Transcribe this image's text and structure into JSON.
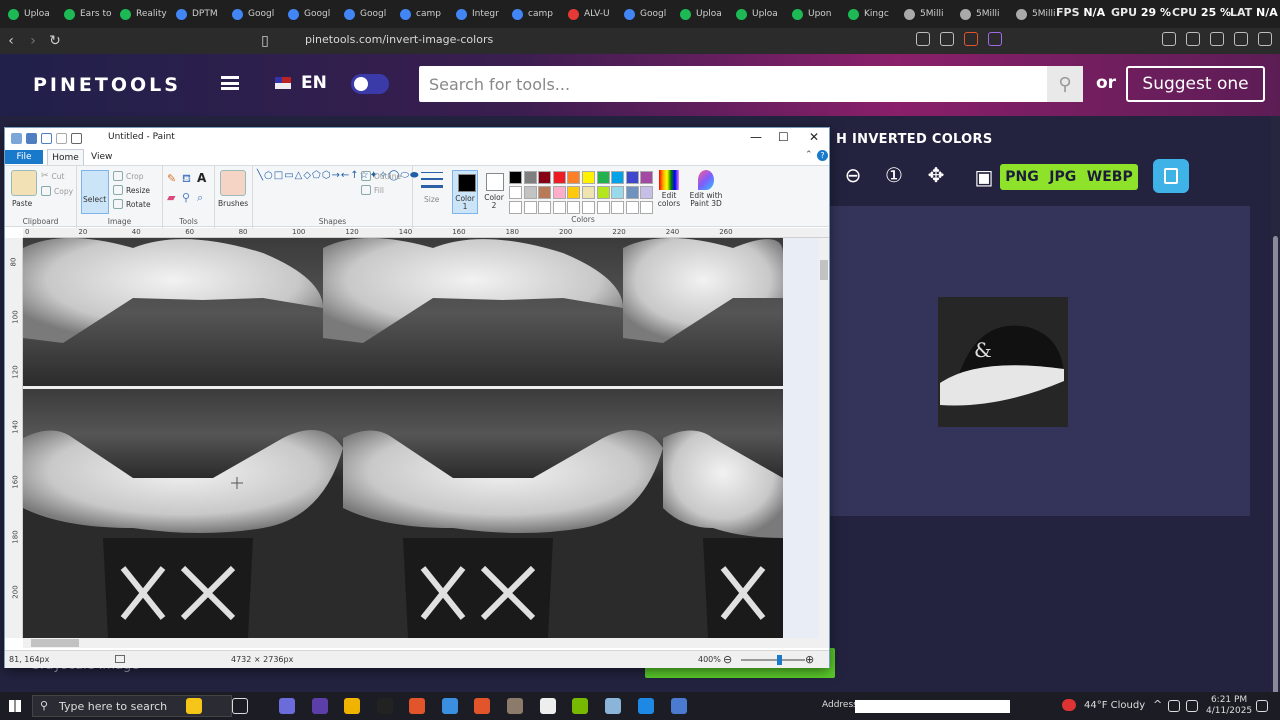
{
  "browser": {
    "tabs": [
      "Uploa",
      "Ears to",
      "Reality",
      "DPTM",
      "Googl",
      "Googl",
      "Googl",
      "camp",
      "Integr",
      "camp",
      "ALV-U",
      "Googl",
      "Uploa",
      "Uploa",
      "Upon",
      "Kingc",
      "5Milli",
      "5Milli",
      "5Milli"
    ],
    "tab_colors": [
      "#1db954",
      "#1db954",
      "#1db954",
      "#4285f4",
      "#4285f4",
      "#4285f4",
      "#4285f4",
      "#4285f4",
      "#4285f4",
      "#4285f4",
      "#e53935",
      "#4285f4",
      "#1db954",
      "#1db954",
      "#1db954",
      "#1db954",
      "#aaaaaa",
      "#aaaaaa",
      "#aaaaaa"
    ],
    "url": "pinetools.com/invert-image-colors",
    "overlay": {
      "fps_label": "FPS",
      "fps": "N/A",
      "gpu_label": "GPU",
      "gpu": "29 %",
      "cpu_label": "CPU",
      "cpu": "25 %",
      "lat_label": "LAT",
      "lat": "N/A"
    }
  },
  "site": {
    "logo": "PINETOOLS",
    "lang": "EN",
    "search_placeholder": "Search for tools...",
    "or": "or",
    "suggest": "Suggest one",
    "panel_title": "H INVERTED COLORS",
    "formats": [
      "PNG",
      "JPG",
      "WEBP"
    ],
    "gray_label": "Grayscale image"
  },
  "paint": {
    "title": "Untitled - Paint",
    "tabs": {
      "file": "File",
      "home": "Home",
      "view": "View"
    },
    "groups": {
      "clipboard": "Clipboard",
      "image": "Image",
      "tools": "Tools",
      "shapes": "Shapes",
      "colors": "Colors"
    },
    "clipboard": {
      "paste": "Paste",
      "cut": "Cut",
      "copy": "Copy"
    },
    "image": {
      "select": "Select",
      "crop": "Crop",
      "resize": "Resize",
      "rotate": "Rotate"
    },
    "brushes": "Brushes",
    "shapes": {
      "outline": "Outline",
      "fill": "Fill"
    },
    "size": "Size",
    "color1": "Color 1",
    "color2": "Color 2",
    "edit_colors": "Edit colors",
    "paint3d": "Edit with Paint 3D",
    "palette": [
      "#000000",
      "#7f7f7f",
      "#880015",
      "#ed1c24",
      "#ff7f27",
      "#fff200",
      "#22b14c",
      "#00a2e8",
      "#3f48cc",
      "#a349a4",
      "#ffffff",
      "#c3c3c3",
      "#b97a57",
      "#ffaec9",
      "#ffc90e",
      "#efe4b0",
      "#b5e61d",
      "#99d9ea",
      "#7092be",
      "#c8bfe7"
    ],
    "ruler_h": [
      "0",
      "20",
      "40",
      "60",
      "80",
      "100",
      "120",
      "140",
      "160",
      "180",
      "200",
      "220",
      "240",
      "260"
    ],
    "ruler_v": [
      "80",
      "100",
      "120",
      "140",
      "160",
      "180",
      "200"
    ],
    "status": {
      "cursor": "81, 164px",
      "dimensions": "4732 × 2736px",
      "zoom": "400%"
    }
  },
  "taskbar": {
    "search": "Type here to search",
    "address_label": "Address",
    "weather": "44°F  Cloudy",
    "time": "6:21 PM",
    "date": "4/11/2025"
  }
}
